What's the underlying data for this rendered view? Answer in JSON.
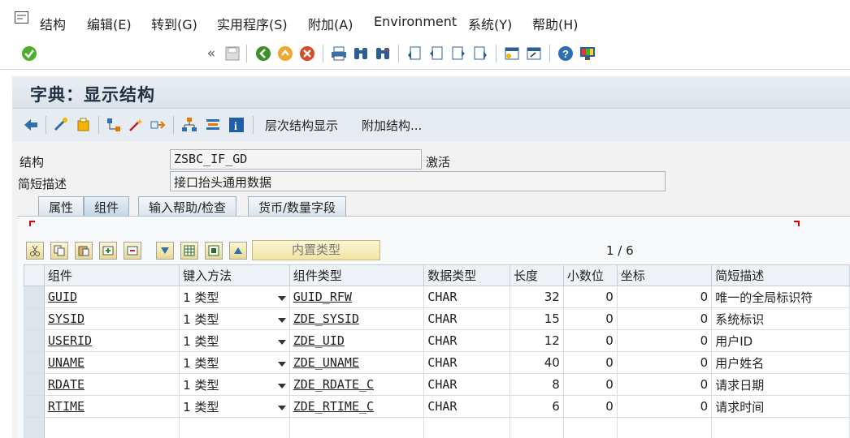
{
  "menu": {
    "items": [
      "结构",
      "编辑(E)",
      "转到(G)",
      "实用程序(S)",
      "附加(A)",
      "Environment",
      "系统(Y)",
      "帮助(H)"
    ]
  },
  "toolbar": {
    "command_value": "",
    "icons": [
      "enter-check-icon",
      "history-arrow-icon",
      "save-icon",
      "back-icon",
      "exit-icon",
      "cancel-icon",
      "print-icon",
      "find-icon",
      "find-next-icon",
      "first-page-icon",
      "prev-page-icon",
      "next-page-icon",
      "last-page-icon",
      "new-session-icon",
      "shortcut-icon",
      "help-icon",
      "customize-icon"
    ]
  },
  "title": "字典：显示结构",
  "app_toolbar": {
    "hierarchy_label": "层次结构显示",
    "append_label": "附加结构..."
  },
  "header": {
    "structure_label": "结构",
    "structure_value": "ZSBC_IF_GD",
    "status": "激活",
    "desc_label": "简短描述",
    "desc_value": "接口抬头通用数据"
  },
  "tabs": [
    "属性",
    "组件",
    "输入帮助/检查",
    "货币/数量字段"
  ],
  "active_tab": "组件",
  "grid": {
    "builtin_label": "内置类型",
    "page_info": "1 / 6",
    "columns": [
      "组件",
      "键入方法",
      "组件类型",
      "数据类型",
      "长度",
      "小数位",
      "坐标",
      "简短描述"
    ],
    "rows": [
      {
        "component": "GUID",
        "method": "1 类型",
        "comp_type": "GUID_RFW",
        "data_type": "CHAR",
        "length": "32",
        "decimals": "0",
        "coord": "0",
        "desc": "唯一的全局标识符"
      },
      {
        "component": "SYSID",
        "method": "1 类型",
        "comp_type": "ZDE_SYSID",
        "data_type": "CHAR",
        "length": "15",
        "decimals": "0",
        "coord": "0",
        "desc": "系统标识"
      },
      {
        "component": "USERID",
        "method": "1 类型",
        "comp_type": "ZDE_UID",
        "data_type": "CHAR",
        "length": "12",
        "decimals": "0",
        "coord": "0",
        "desc": "用户ID"
      },
      {
        "component": "UNAME",
        "method": "1 类型",
        "comp_type": "ZDE_UNAME",
        "data_type": "CHAR",
        "length": "40",
        "decimals": "0",
        "coord": "0",
        "desc": "用户姓名"
      },
      {
        "component": "RDATE",
        "method": "1 类型",
        "comp_type": "ZDE_RDATE_C",
        "data_type": "CHAR",
        "length": "8",
        "decimals": "0",
        "coord": "0",
        "desc": "请求日期"
      },
      {
        "component": "RTIME",
        "method": "1 类型",
        "comp_type": "ZDE_RTIME_C",
        "data_type": "CHAR",
        "length": "6",
        "decimals": "0",
        "coord": "0",
        "desc": "请求时间"
      }
    ]
  },
  "colors": {
    "accent": "#1f3a5a",
    "panel": "#e6ecf1",
    "button": "#f0e3a3"
  }
}
